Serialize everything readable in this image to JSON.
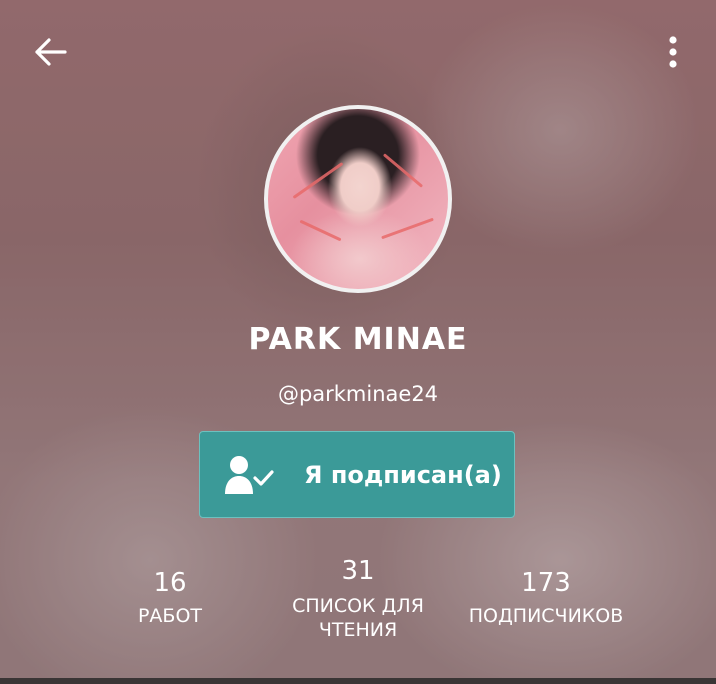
{
  "header": {
    "back_icon": "arrow-left-icon",
    "more_icon": "more-vertical-icon"
  },
  "profile": {
    "name": "PARK MINAE",
    "handle": "@parkminae24",
    "avatar": "user-avatar-photo"
  },
  "follow_button": {
    "label": "Я подписан(а)",
    "icon": "user-check-icon",
    "color": "#3b9a98"
  },
  "stats": {
    "works": {
      "value": "16",
      "label": "РАБОТ"
    },
    "reading_list": {
      "value": "31",
      "label_line1": "СПИСОК ДЛЯ",
      "label_line2": "ЧТЕНИЯ"
    },
    "followers": {
      "value": "173",
      "label": "ПОДПИСЧИКОВ"
    }
  }
}
